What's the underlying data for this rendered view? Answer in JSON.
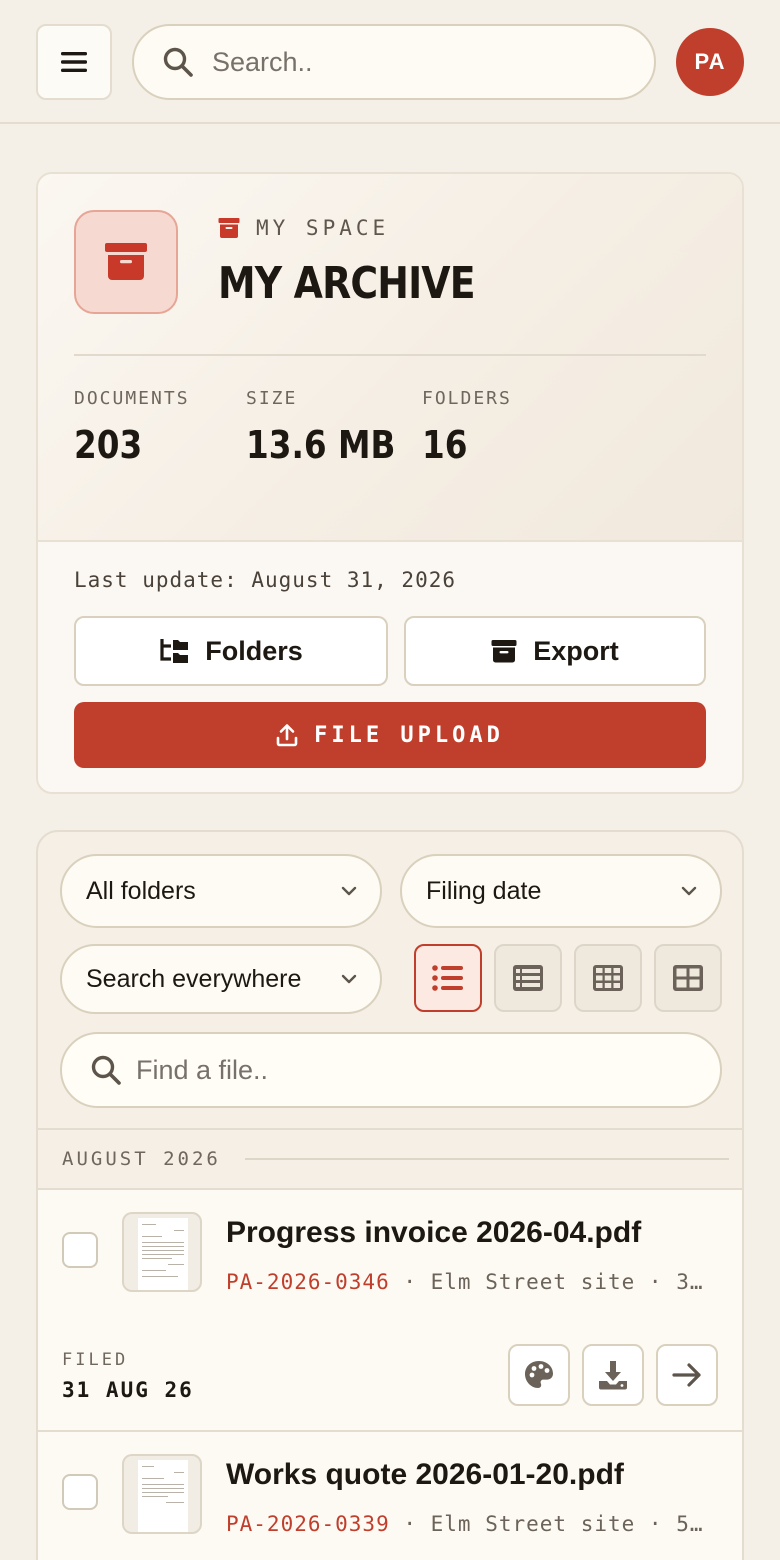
{
  "header": {
    "search_placeholder": "Search..",
    "avatar_initials": "PA"
  },
  "archive": {
    "eyebrow": "MY SPACE",
    "title": "MY ARCHIVE",
    "stats": [
      {
        "label": "DOCUMENTS",
        "value": "203"
      },
      {
        "label": "SIZE",
        "value": "13.6 MB"
      },
      {
        "label": "FOLDERS",
        "value": "16"
      }
    ],
    "last_update": "Last update: August 31, 2026",
    "folders_label": "Folders",
    "export_label": "Export",
    "upload_label": "FILE UPLOAD"
  },
  "filters": {
    "folder_select": "All folders",
    "sort_select": "Filing date",
    "scope_select": "Search everywhere",
    "find_placeholder": "Find a file.."
  },
  "group": {
    "label": "AUGUST 2026"
  },
  "files": [
    {
      "name": "Progress invoice 2026-04.pdf",
      "ref": "PA-2026-0346",
      "meta": " · Elm Street site · 3…",
      "filed_label": "FILED",
      "filed_date": "31 AUG 26"
    },
    {
      "name": "Works quote 2026-01-20.pdf",
      "ref": "PA-2026-0339",
      "meta": " · Elm Street site · 5…"
    }
  ],
  "colors": {
    "accent": "#c03f2c",
    "background": "#f4efe7"
  },
  "icons": {
    "menu": "hamburger-icon",
    "search": "search-icon",
    "archive": "archive-box-icon",
    "folders": "folder-tree-icon",
    "export": "export-box-icon",
    "upload": "upload-icon",
    "views": [
      "list-view-icon",
      "table-view-icon",
      "grid-view-icon",
      "large-grid-view-icon"
    ],
    "row_actions": [
      "palette-icon",
      "download-icon",
      "arrow-right-icon"
    ]
  }
}
